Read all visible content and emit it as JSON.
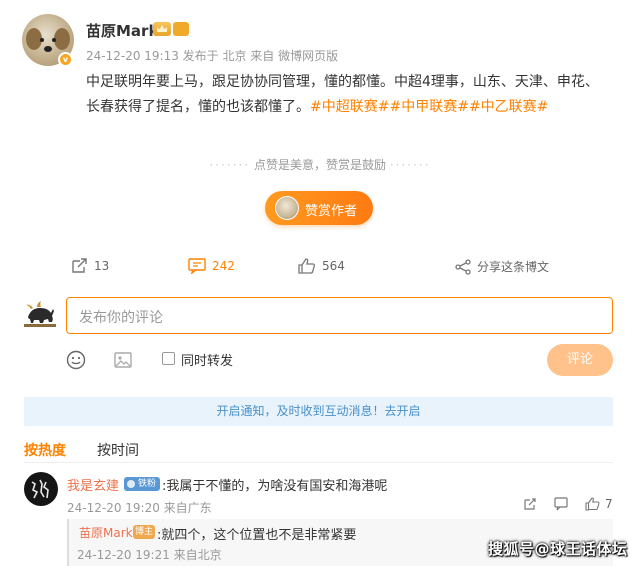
{
  "post": {
    "author": "苗原Mark",
    "meta": "24-12-20 19:13 发布于 北京 来自 微博网页版",
    "text": "中足联明年要上马，跟足协协同管理，懂的都懂。中超4理事，山东、天津、申花、长春获得了提名，懂的也该都懂了。",
    "tags": [
      "#中超联赛#",
      "#中甲联赛#",
      "#中乙联赛#"
    ],
    "divider": "点赞是美意，赞赏是鼓励",
    "reward_label": "赞赏作者"
  },
  "actions": {
    "repost_count": "13",
    "comment_count": "242",
    "like_count": "564",
    "share_label": "分享这条博文"
  },
  "composer": {
    "placeholder": "发布你的评论",
    "repost_label": "同时转发",
    "submit_label": "评论"
  },
  "notice": "开启通知，及时收到互动消息！去开启",
  "sort": {
    "hot": "按热度",
    "time": "按时间"
  },
  "comments": [
    {
      "user": "我是玄建",
      "badge": "铁粉",
      "text": ":我属于不懂的，为啥没有国安和海港呢",
      "meta": "24-12-20 19:20 来自广东",
      "likes": "7",
      "reply": {
        "user": "苗原Mark",
        "badge": "博主",
        "text": ":就四个，这个位置也不是非常紧要",
        "meta": "24-12-20 19:21 来自北京"
      }
    }
  ],
  "watermark": "搜狐号@球王话体坛",
  "colors": {
    "accent": "#ff8200",
    "tag": "#ff8200",
    "name": "#eb7350",
    "notice_bg": "#e8f3fc"
  }
}
